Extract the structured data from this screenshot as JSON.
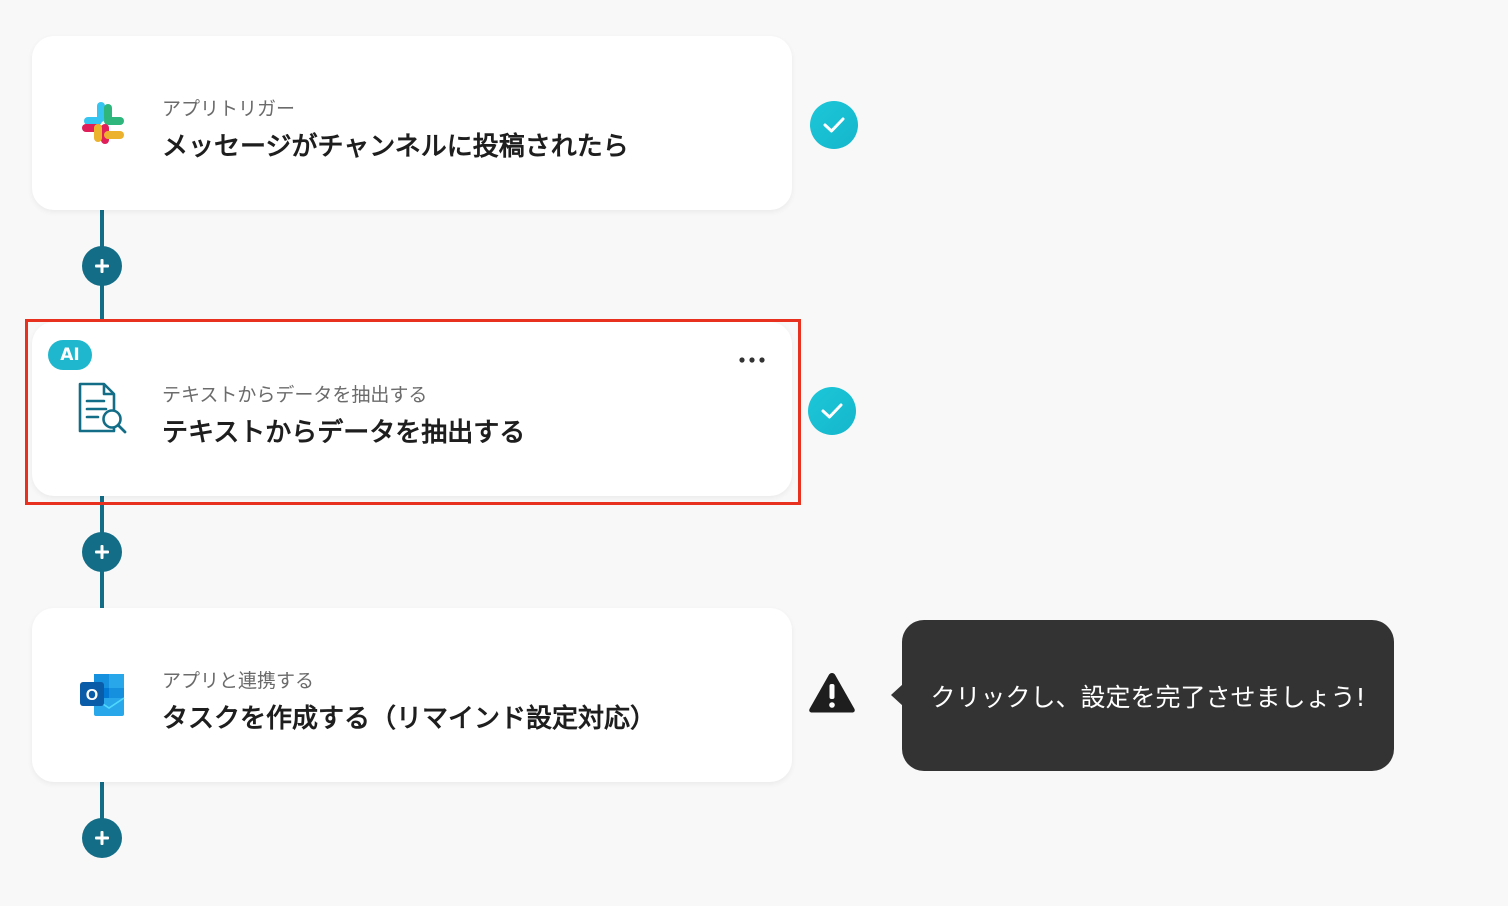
{
  "steps": [
    {
      "type_label": "アプリトリガー",
      "title": "メッセージがチャンネルに投稿されたら",
      "app_icon": "slack-icon",
      "status": "complete"
    },
    {
      "type_label": "テキストからデータを抽出する",
      "title": "テキストからデータを抽出する",
      "app_icon": "document-search-icon",
      "badge": "AI",
      "status": "complete",
      "highlighted": true
    },
    {
      "type_label": "アプリと連携する",
      "title": "タスクを作成する（リマインド設定対応）",
      "app_icon": "outlook-icon",
      "status": "warning"
    }
  ],
  "tooltip": {
    "text": "クリックし、設定を完了させましょう!"
  },
  "colors": {
    "background": "#f8f8f8",
    "connector": "#136d87",
    "check": "#1cc7d8",
    "highlight": "#e8321f",
    "tooltip_bg": "#333333",
    "ai_badge": "#1fb7cd"
  }
}
